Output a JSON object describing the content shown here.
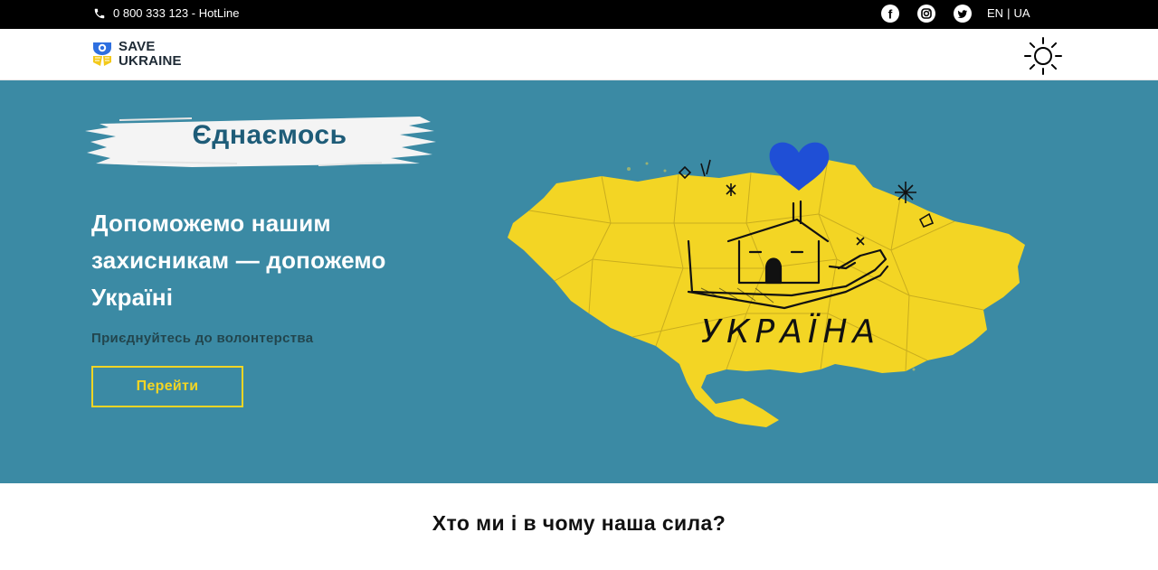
{
  "topbar": {
    "hotline": "0 800 333 123 - HotLine",
    "socials": [
      "facebook-icon",
      "instagram-icon",
      "twitter-icon"
    ],
    "lang_en": "EN",
    "lang_sep": "|",
    "lang_ua": "UA"
  },
  "header": {
    "logo_line1": "SAVE",
    "logo_line2": "UKRAINE"
  },
  "hero": {
    "tag": "Єднаємось",
    "title": "Допоможемо нашим захисникам — допожемо Україні",
    "subtitle": "Приєднуйтесь до волонтерства",
    "cta_label": "Перейти",
    "map_label": "УКРАЇНА"
  },
  "section": {
    "title": "Хто ми і в чому наша сила?"
  },
  "colors": {
    "hero_bg": "#3b8aa4",
    "yellow": "#f3d524",
    "blue": "#1f4fd6",
    "black": "#000000"
  }
}
